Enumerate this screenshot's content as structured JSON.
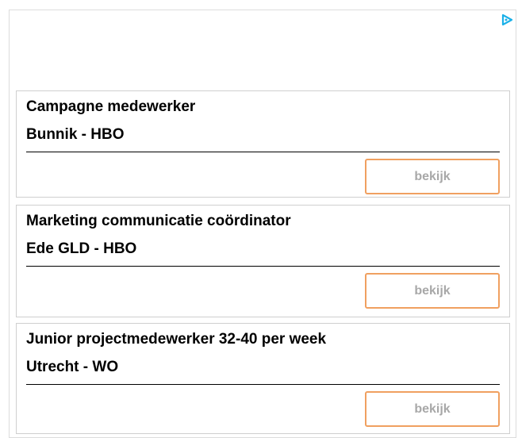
{
  "icons": {
    "ad_badge": "adchoices-icon"
  },
  "jobs": [
    {
      "title": "Campagne medewerker",
      "location": "Bunnik - HBO",
      "button_label": "bekijk"
    },
    {
      "title": "Marketing communicatie coördinator",
      "location": "Ede GLD - HBO",
      "button_label": "bekijk"
    },
    {
      "title": "Junior projectmedewerker 32-40 per week",
      "location": "Utrecht - WO",
      "button_label": "bekijk"
    }
  ],
  "colors": {
    "button_border": "#f0a060",
    "button_text": "#a8a8a8",
    "ad_icon": "#1ab0e8"
  }
}
